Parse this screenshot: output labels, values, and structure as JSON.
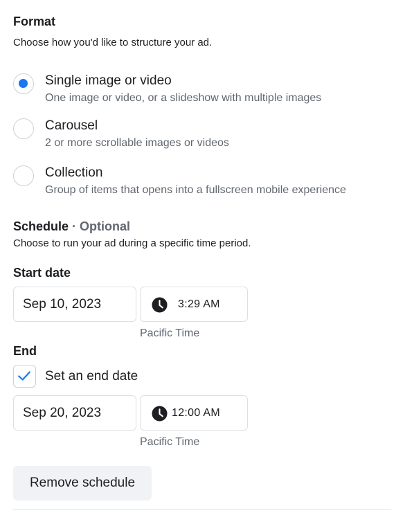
{
  "format": {
    "title": "Format",
    "subtitle": "Choose how you'd like to structure your ad.",
    "options": [
      {
        "label": "Single image or video",
        "description": "One image or video, or a slideshow with multiple images",
        "selected": true
      },
      {
        "label": "Carousel",
        "description": "2 or more scrollable images or videos",
        "selected": false
      },
      {
        "label": "Collection",
        "description": "Group of items that opens into a fullscreen mobile experience",
        "selected": false
      }
    ]
  },
  "schedule": {
    "title": "Schedule",
    "separator": " · ",
    "optional": "Optional",
    "subtitle": "Choose to run your ad during a specific time period.",
    "start": {
      "label": "Start date",
      "date": "Sep 10, 2023",
      "time": "3:29 AM",
      "timezone": "Pacific Time"
    },
    "end": {
      "label": "End",
      "checkbox_label": "Set an end date",
      "checkbox_checked": true,
      "date": "Sep 20, 2023",
      "time": "12:00 AM",
      "timezone": "Pacific Time"
    },
    "remove_button": "Remove schedule"
  },
  "colors": {
    "accent": "#1877f2",
    "text": "#1c1e21",
    "secondary_text": "#606770",
    "border": "#dddfe2",
    "button_bg": "#f0f2f5"
  },
  "icons": {
    "clock": "clock-icon",
    "check": "checkmark-icon"
  }
}
